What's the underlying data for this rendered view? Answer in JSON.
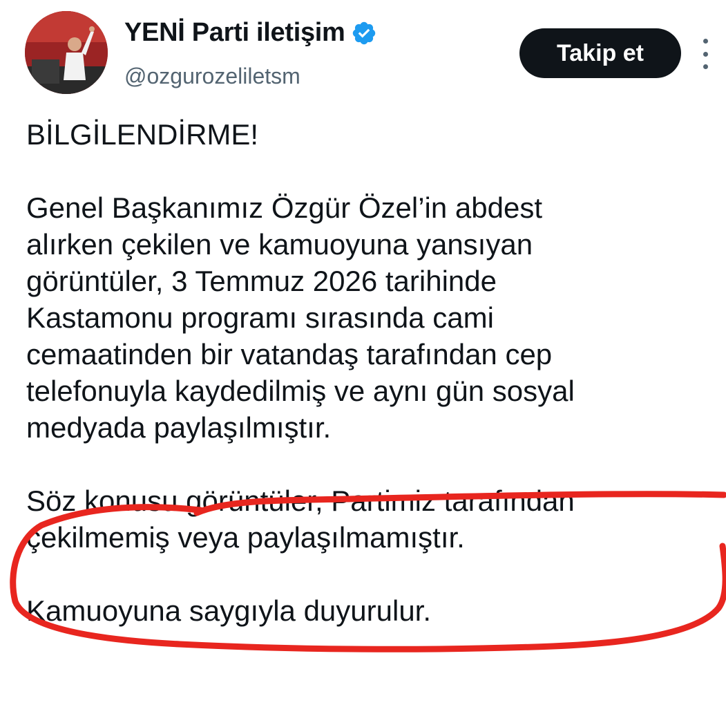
{
  "author": {
    "display_name": "YENİ Parti iletişim",
    "handle": "@ozgurozeliletsm",
    "verified": true,
    "avatar_icon": "profile-photo"
  },
  "actions": {
    "follow_label": "Takip et",
    "more_icon": "three-dots-vertical-icon"
  },
  "tweet": {
    "heading": "BİLGİLENDİRME!",
    "paragraph1_lines": [
      "Genel Başkanımız Özgür Özel’in abdest",
      "alırken çekilen ve kamuoyuna yansıyan",
      "görüntüler, 3 Temmuz 2026 tarihinde",
      "Kastamonu programı sırasında cami",
      "cemaatinden bir vatandaş tarafından cep",
      "telefonuyla kaydedilmiş ve aynı gün sosyal",
      "medyada paylaşılmıştır."
    ],
    "paragraph2_lines": [
      "Söz konusu görüntüler, Partimiz tarafından",
      "çekilmemiş veya paylaşılmamıştır."
    ],
    "closing": "Kamuoyuna saygıyla duyurulur."
  },
  "colors": {
    "verified_badge": "#1d9bf0",
    "follow_button_bg": "#0f1419",
    "secondary_text": "#536471",
    "annotation_red": "#e8261f"
  }
}
